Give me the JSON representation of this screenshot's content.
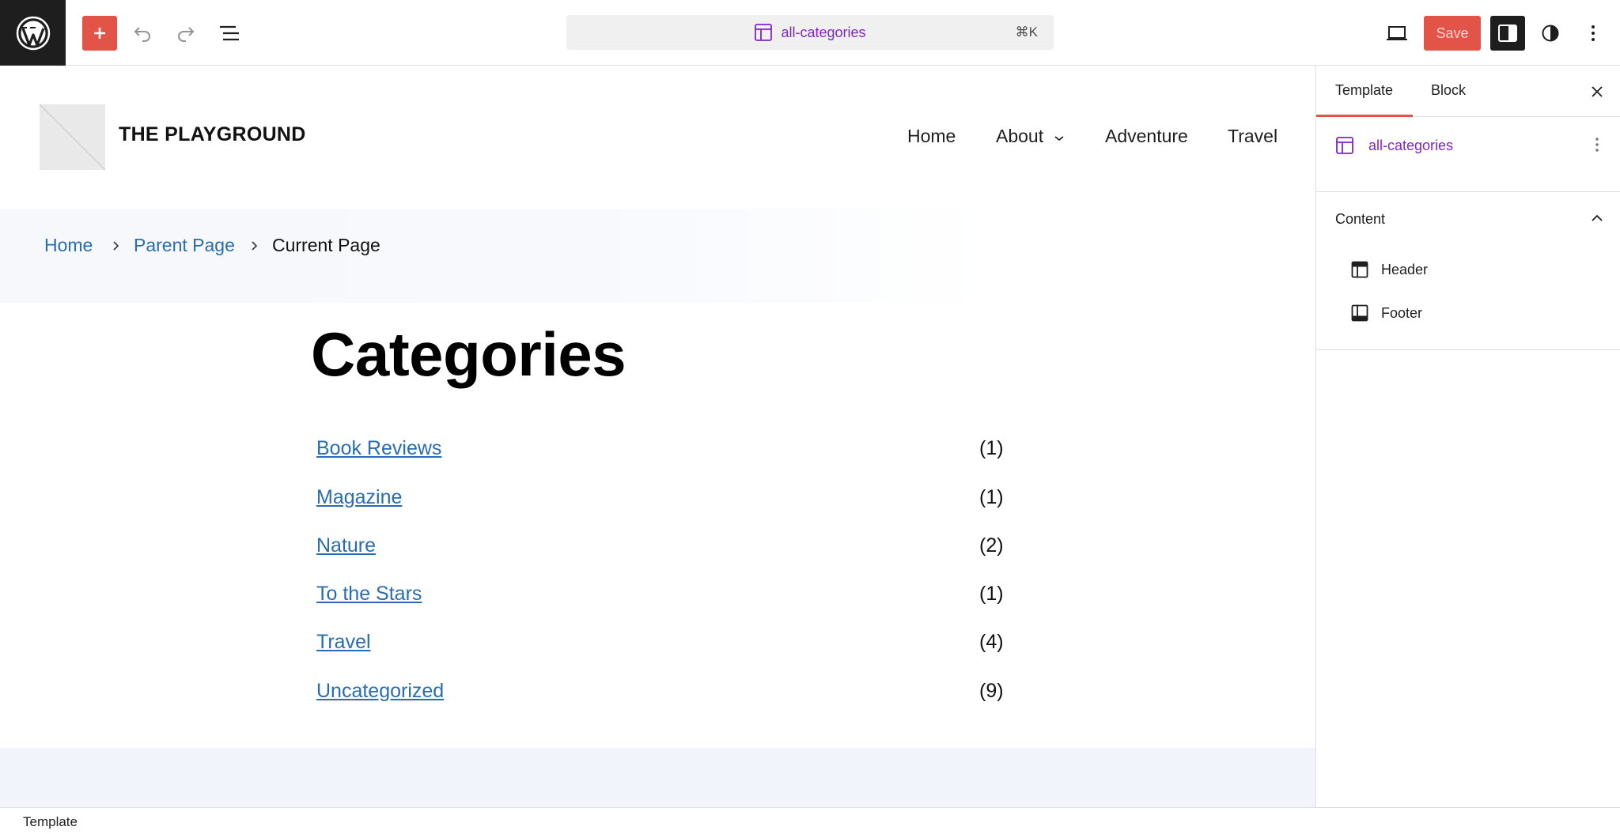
{
  "toolbar": {
    "command_title": "all-categories",
    "command_shortcut": "⌘K",
    "save_label": "Save",
    "icons": [
      "wordpress-logo-icon",
      "plus-icon",
      "undo-icon",
      "redo-icon",
      "list-view-icon",
      "layout-icon",
      "desktop-view-icon",
      "settings-sidebar-icon",
      "styles-contrast-icon",
      "more-vertical-icon"
    ],
    "accent": "#e25448",
    "template_color": "#8224c7"
  },
  "site": {
    "title": "THE PLAYGROUND",
    "nav": [
      "Home",
      "About",
      "Adventure",
      "Travel"
    ]
  },
  "breadcrumb": {
    "items": [
      "Home",
      "Parent Page",
      "Current Page"
    ]
  },
  "page": {
    "heading": "Categories",
    "categories": [
      {
        "name": "Book Reviews",
        "count": "(1)"
      },
      {
        "name": "Magazine",
        "count": "(1)"
      },
      {
        "name": "Nature",
        "count": "(2)"
      },
      {
        "name": "To the Stars",
        "count": "(1)"
      },
      {
        "name": "Travel",
        "count": "(4)"
      },
      {
        "name": "Uncategorized",
        "count": "(9)"
      }
    ],
    "link_color": "#2a6cb0"
  },
  "sidebar": {
    "tabs": [
      "Template",
      "Block"
    ],
    "template_name": "all-categories",
    "content_title": "Content",
    "parts": [
      "Header",
      "Footer"
    ]
  },
  "statusbar": {
    "text": "Template"
  }
}
